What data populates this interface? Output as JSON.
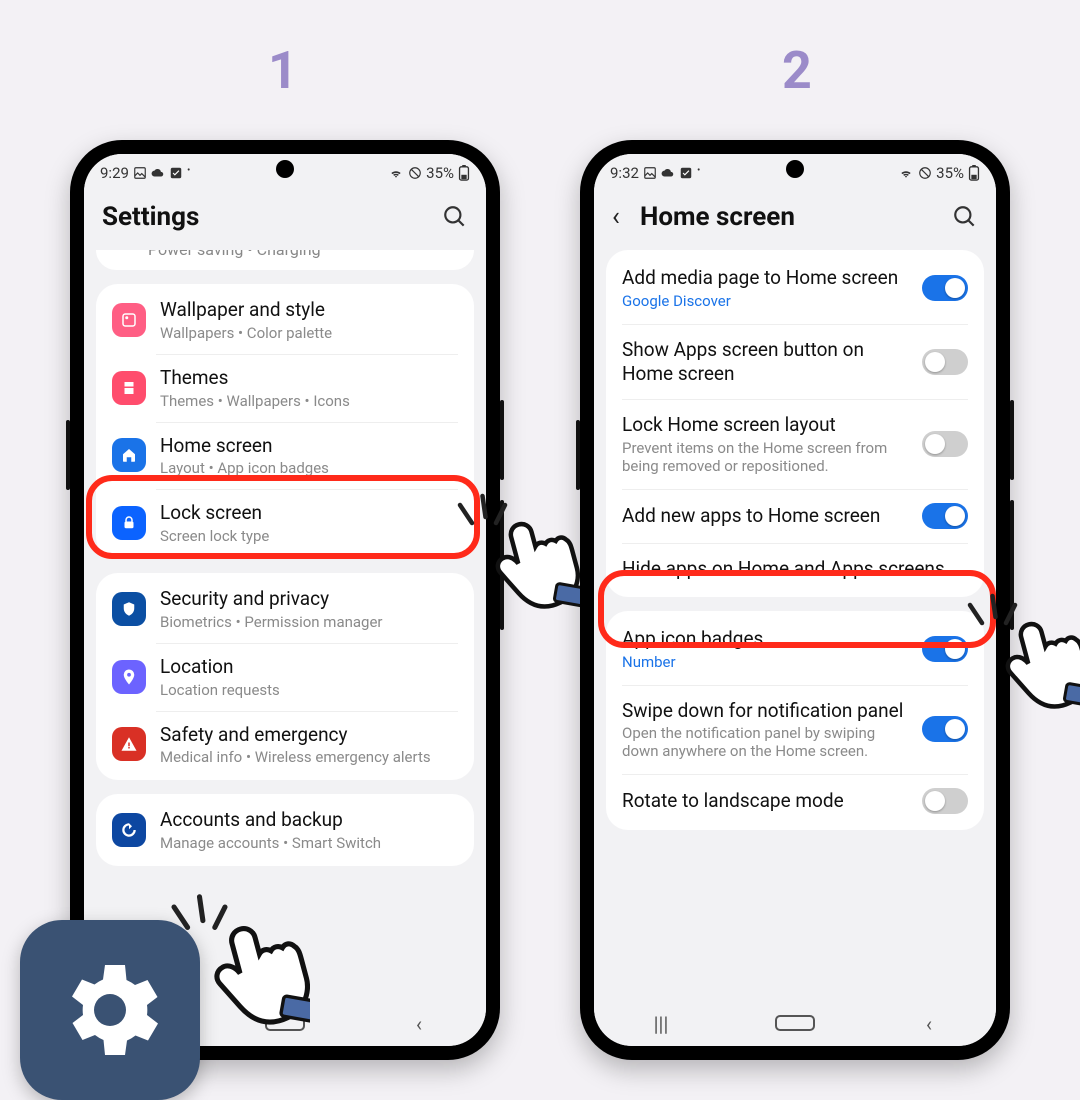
{
  "steps": {
    "one": "1",
    "two": "2"
  },
  "phone1": {
    "status": {
      "time": "9:29",
      "battery": "35%"
    },
    "header": {
      "title": "Settings"
    },
    "truncated_text": "Power saving  •  Charging",
    "items": [
      {
        "title": "Wallpaper and style",
        "sub": "Wallpapers  •  Color palette",
        "color": "bg-pink",
        "icon": "wallpaper"
      },
      {
        "title": "Themes",
        "sub": "Themes  •  Wallpapers  •  Icons",
        "color": "bg-rose",
        "icon": "themes"
      },
      {
        "title": "Home screen",
        "sub": "Layout  •  App icon badges",
        "color": "bg-blue",
        "icon": "home"
      },
      {
        "title": "Lock screen",
        "sub": "Screen lock type",
        "color": "bg-blue2",
        "icon": "lock"
      }
    ],
    "items2": [
      {
        "title": "Security and privacy",
        "sub": "Biometrics  •  Permission manager",
        "color": "bg-navy",
        "icon": "shield"
      },
      {
        "title": "Location",
        "sub": "Location requests",
        "color": "bg-purple",
        "icon": "pin"
      },
      {
        "title": "Safety and emergency",
        "sub": "Medical info  •  Wireless emergency alerts",
        "color": "bg-red",
        "icon": "alert"
      }
    ],
    "items3_title": "Accounts and backup",
    "items3_sub": "Manage accounts  •  Smart Switch"
  },
  "phone2": {
    "status": {
      "time": "9:32",
      "battery": "35%"
    },
    "header": {
      "title": "Home screen"
    },
    "group1": [
      {
        "title": "Add media page to Home screen",
        "sub": "Google Discover",
        "sub_blue": true,
        "toggle": "on"
      },
      {
        "title": "Show Apps screen button on Home screen",
        "toggle": "off"
      },
      {
        "title": "Lock Home screen layout",
        "sub": "Prevent items on the Home screen from being removed or repositioned.",
        "toggle": "off"
      },
      {
        "title": "Add new apps to Home screen",
        "toggle": "on"
      },
      {
        "title": "Hide apps on Home and Apps screens"
      }
    ],
    "group2": [
      {
        "title": "App icon badges",
        "sub": "Number",
        "sub_blue": true,
        "toggle": "on"
      },
      {
        "title": "Swipe down for notification panel",
        "sub": "Open the notification panel by swiping down anywhere on the Home screen.",
        "toggle": "on"
      },
      {
        "title": "Rotate to landscape mode",
        "toggle": "off"
      }
    ]
  }
}
